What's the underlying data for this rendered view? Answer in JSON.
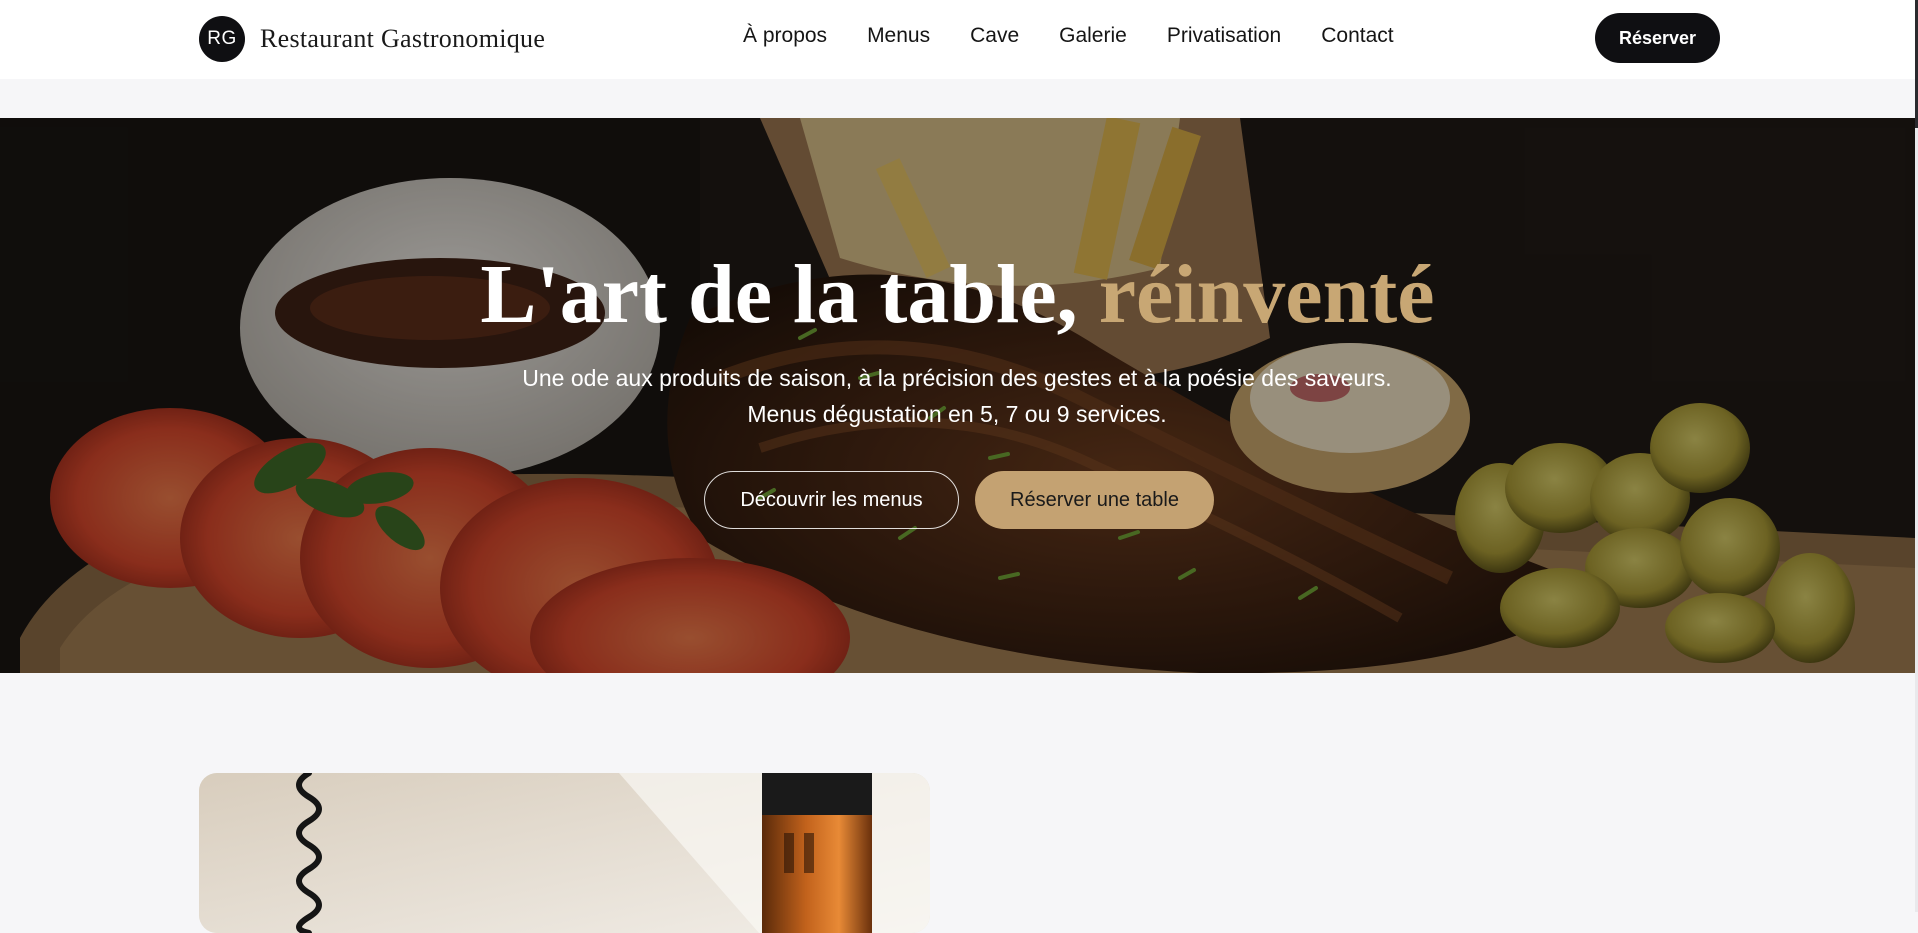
{
  "header": {
    "logo_initials": "RG",
    "brand_name": "Restaurant Gastronomique",
    "nav": [
      {
        "label": "À propos"
      },
      {
        "label": "Menus"
      },
      {
        "label": "Cave"
      },
      {
        "label": "Galerie"
      },
      {
        "label": "Privatisation"
      },
      {
        "label": "Contact"
      }
    ],
    "cta_label": "Réserver"
  },
  "hero": {
    "title_main": "L'art de la table,",
    "title_accent": "réinventé",
    "subtitle": "Une ode aux produits de saison, à la précision des gestes et à la poésie des saveurs. Menus dégustation en 5, 7 ou 9 services.",
    "primary_button": "Découvrir les menus",
    "secondary_button": "Réserver une table",
    "image_subject": "grilled ribs with tomatoes, pickles, fries and sauce"
  },
  "colors": {
    "accent_gold": "#c4a272",
    "dark": "#0f0f12",
    "page_bg": "#f6f6f8"
  },
  "feature": {
    "image_subject": "corkscrew and wine bottle"
  }
}
